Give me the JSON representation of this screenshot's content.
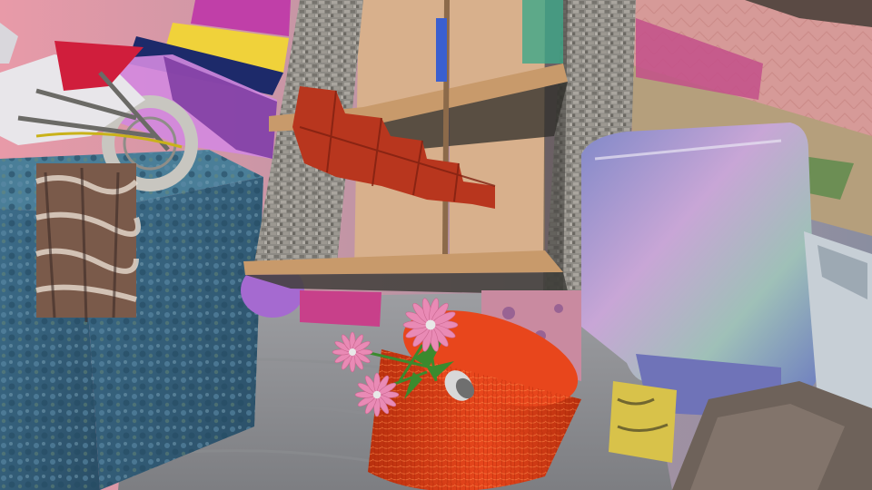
{
  "scene": {
    "kind": "synthetic-3d-render",
    "colors": {
      "sky_left": "#e89aa8",
      "sky_right": "#8a8ea0",
      "floor": "#9d9ea2",
      "floor_dark": "#7d7e82",
      "blue_block": "#3d6d8a",
      "blue_block_dark": "#2a4e66",
      "shelf_wood": "#c89a6b",
      "shelf_back": "#d8b08c",
      "stone": "#8d8a84",
      "stone_dark": "#5e5c58",
      "red_stairs": "#b8361e",
      "red_stairs_dark": "#7e2010",
      "orange_barrel": "#e8461c",
      "orange_barrel_dark": "#b8300e",
      "pastel_box": "#a4a8cc",
      "flower_pink": "#e98ab5",
      "flower_center": "#e8e8e8",
      "flower_stem": "#3b8a2e",
      "motorbike_red": "#d01e3c",
      "motorbike_white": "#e8e6ea",
      "magenta_panel": "#c03fa8",
      "yellow_panel": "#f0d23a",
      "pink_wall": "#d69a98",
      "dark_wall": "#5a4a44"
    }
  }
}
